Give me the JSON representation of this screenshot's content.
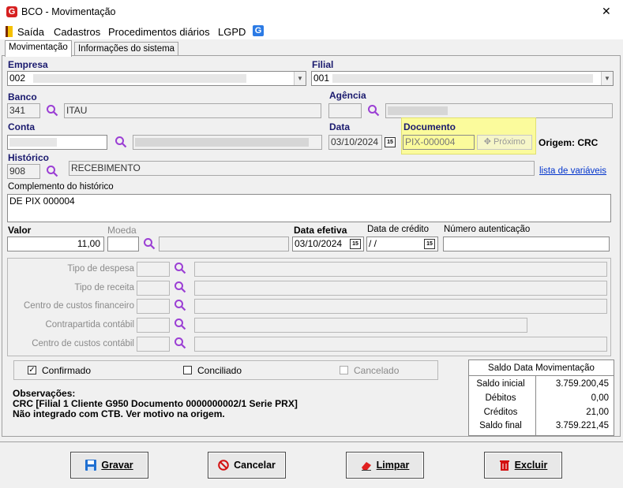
{
  "window": {
    "title": "BCO - Movimentação",
    "close_glyph": "✕",
    "logo_letter": "G"
  },
  "menu": {
    "items": [
      "Saída",
      "Cadastros",
      "Procedimentos diários",
      "LGPD"
    ],
    "g_letter": "G"
  },
  "tabs": [
    "Movimentação",
    "Informações do sistema"
  ],
  "form": {
    "empresa": {
      "label": "Empresa",
      "code": "002"
    },
    "filial": {
      "label": "Filial",
      "code": "001"
    },
    "banco": {
      "label": "Banco",
      "code": "341",
      "name": "ITAU"
    },
    "agencia": {
      "label": "Agência"
    },
    "conta": {
      "label": "Conta"
    },
    "data": {
      "label": "Data",
      "value": "03/10/2024",
      "cal": "15"
    },
    "documento": {
      "label": "Documento",
      "value": "PIX-000004",
      "next_label": "Próximo",
      "next_glyph": "✥"
    },
    "origem": "Origem: CRC",
    "historico": {
      "label": "Histórico",
      "code": "908",
      "name": "RECEBIMENTO"
    },
    "variaveis_link": "lista de variáveis",
    "complemento": {
      "label": "Complemento do histórico",
      "value": "DE PIX 000004"
    },
    "valor": {
      "label": "Valor",
      "value": "11,00"
    },
    "moeda": {
      "label": "Moeda"
    },
    "data_efetiva": {
      "label": "Data efetiva",
      "value": "03/10/2024",
      "cal": "15"
    },
    "data_credito": {
      "label": "Data de crédito",
      "value": " / /",
      "cal": "15"
    },
    "autenticacao": {
      "label": "Número autenticação"
    }
  },
  "classificacao": [
    {
      "label": "Tipo de despesa"
    },
    {
      "label": "Tipo de receita"
    },
    {
      "label": "Centro de custos financeiro"
    },
    {
      "label": "Contrapartida contábil"
    },
    {
      "label": "Centro de custos contábil"
    }
  ],
  "status": {
    "confirmado": {
      "label": "Confirmado",
      "checked": true,
      "glyph": "✓"
    },
    "conciliado": {
      "label": "Conciliado",
      "checked": false
    },
    "cancelado": {
      "label": "Cancelado",
      "checked": false
    }
  },
  "observacoes": {
    "title": "Observações:",
    "line1": "CRC [Filial 1 Cliente G950 Documento 0000000002/1 Serie PRX]",
    "line2": "Não integrado com CTB. Ver motivo na origem."
  },
  "saldo": {
    "title": "Saldo Data Movimentação",
    "rows": [
      {
        "label": "Saldo inicial",
        "value": "3.759.200,45"
      },
      {
        "label": "Débitos",
        "value": "0,00"
      },
      {
        "label": "Créditos",
        "value": "21,00"
      },
      {
        "label": "Saldo final",
        "value": "3.759.221,45"
      }
    ]
  },
  "buttons": {
    "gravar": "Gravar",
    "cancelar": "Cancelar",
    "limpar": "Limpar",
    "excluir": "Excluir"
  },
  "colors": {
    "accent_label": "#1a1a6e",
    "highlight": "#fbfb9c",
    "link": "#0033cc",
    "logo": "#d62020"
  },
  "icons": [
    "app-logo-icon",
    "exit-icon",
    "g-icon",
    "search-icon",
    "dropdown-arrow-icon",
    "calendar-icon",
    "save-icon",
    "cancel-icon",
    "eraser-icon",
    "trash-icon"
  ]
}
